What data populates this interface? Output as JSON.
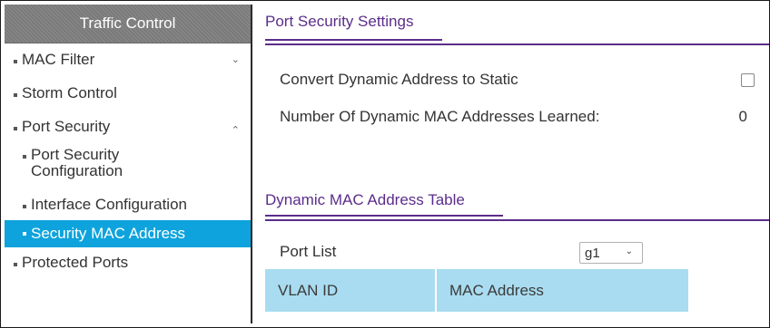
{
  "sidebar": {
    "header": "Traffic Control",
    "items": [
      {
        "label": "MAC Filter",
        "chevron": "down"
      },
      {
        "label": "Storm Control"
      },
      {
        "label": "Port Security",
        "chevron": "up"
      },
      {
        "label": "Port Security Configuration"
      },
      {
        "label": "Interface Configuration"
      },
      {
        "label": "Security MAC Address",
        "active": true
      },
      {
        "label": "Protected Ports"
      }
    ]
  },
  "main": {
    "port_security_settings": {
      "title": "Port Security Settings",
      "convert_label": "Convert Dynamic Address to Static",
      "learned_label": "Number Of Dynamic MAC Addresses Learned:",
      "learned_value": "0"
    },
    "dynamic_table": {
      "title": "Dynamic MAC Address Table",
      "port_list_label": "Port List",
      "port_list_value": "g1",
      "columns": [
        "VLAN ID",
        "MAC Address"
      ]
    }
  },
  "colors": {
    "accent_purple": "#5b2d8a",
    "active_blue": "#0ea3dc",
    "table_header": "#a9dcf0"
  }
}
